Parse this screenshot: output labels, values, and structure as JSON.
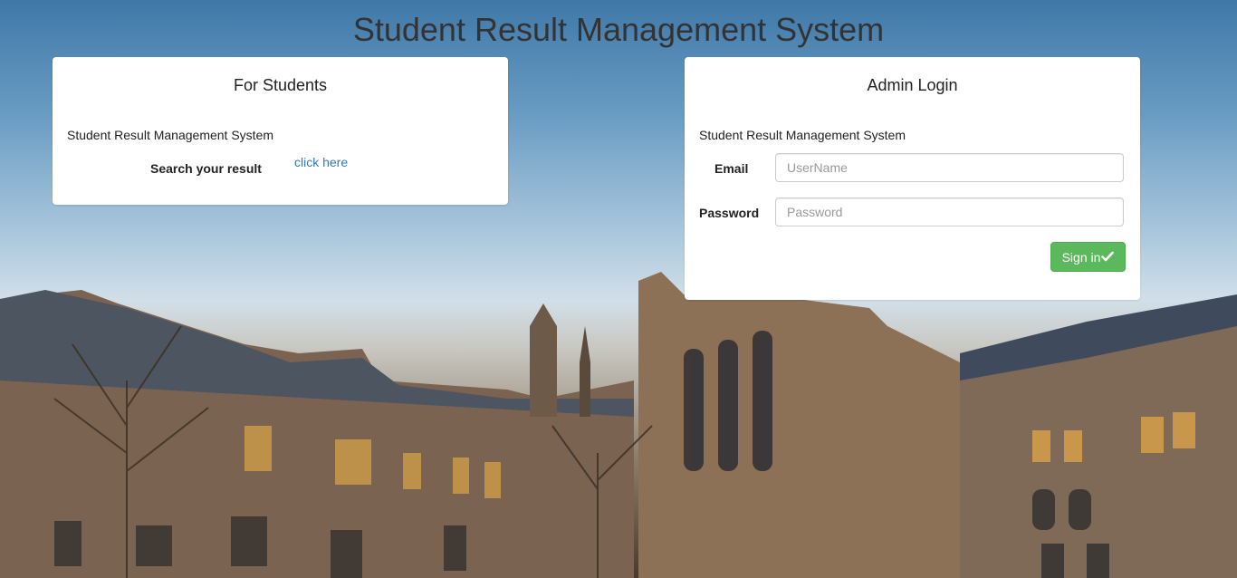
{
  "page": {
    "title": "Student Result Management System"
  },
  "students_panel": {
    "heading": "For Students",
    "subtitle": "Student Result Management System",
    "search_label": "Search your result",
    "link_text": "click here"
  },
  "admin_panel": {
    "heading": "Admin Login",
    "subtitle": "Student Result Management System",
    "email_label": "Email",
    "email_placeholder": "UserName",
    "password_label": "Password",
    "password_placeholder": "Password",
    "signin_label": "Sign in",
    "signin_icon": "check-icon"
  },
  "colors": {
    "link": "#337ab7",
    "success_button": "#5cb85c"
  }
}
